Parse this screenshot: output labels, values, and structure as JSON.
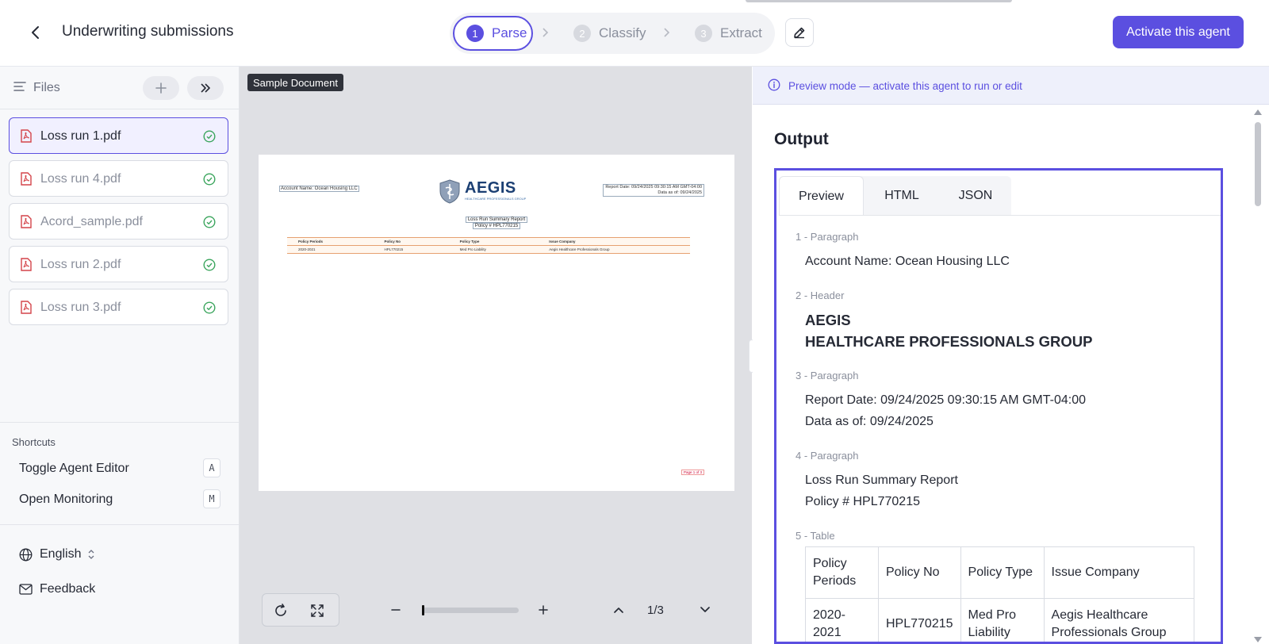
{
  "header": {
    "title": "Underwriting submissions",
    "steps": [
      {
        "num": "1",
        "label": "Parse"
      },
      {
        "num": "2",
        "label": "Classify"
      },
      {
        "num": "3",
        "label": "Extract"
      }
    ],
    "activate_label": "Activate this agent",
    "accent": "#5b4fe0"
  },
  "sidebar": {
    "files_label": "Files",
    "files": [
      {
        "name": "Loss run 1.pdf",
        "status": "check-circle-icon"
      },
      {
        "name": "Loss run 4.pdf",
        "status": "check-circle-icon"
      },
      {
        "name": "Acord_sample.pdf",
        "status": "check-circle-icon"
      },
      {
        "name": "Loss run 2.pdf",
        "status": "check-circle-icon"
      },
      {
        "name": "Loss run 3.pdf",
        "status": "check-circle-icon"
      }
    ],
    "shortcuts_title": "Shortcuts",
    "shortcuts": [
      {
        "label": "Toggle Agent Editor",
        "key": "A"
      },
      {
        "label": "Open Monitoring",
        "key": "M"
      }
    ],
    "language": "English",
    "feedback": "Feedback"
  },
  "viewer": {
    "tag": "Sample Document",
    "page": {
      "account": "Account Name: Ocean Housing LLC",
      "logo_word": "AEGIS",
      "logo_sub": "HEALTHCARE PROFESSIONALS GROUP",
      "report_date": "Report Date: 09/24/2025 09:30:15 AM GMT-04:00",
      "data_as_of": "Data as of: 09/24/2025",
      "title": "Loss Run Summary Report",
      "policy": "Policy # HPL770215",
      "table_head": [
        "Policy Periods",
        "Policy No",
        "Policy Type",
        "Issue Company"
      ],
      "table_row": [
        "2020-2021",
        "HPL770215",
        "Med Pro Liability",
        "Aegis Healthcare Professionals Group"
      ],
      "footer": "Page 1 of 3"
    },
    "zoom_fraction": 0.0,
    "page_indicator": "1/3"
  },
  "output": {
    "banner": "Preview mode — activate this agent to run or edit",
    "title": "Output",
    "tabs": [
      "Preview",
      "HTML",
      "JSON"
    ],
    "blocks": [
      {
        "label": "1 - Paragraph",
        "lines": [
          "Account Name: Ocean Housing LLC"
        ]
      },
      {
        "label": "2 - Header",
        "lines": [
          "AEGIS",
          "HEALTHCARE PROFESSIONALS GROUP"
        ]
      },
      {
        "label": "3 - Paragraph",
        "lines": [
          "Report Date: 09/24/2025 09:30:15 AM GMT-04:00",
          "Data as of: 09/24/2025"
        ]
      },
      {
        "label": "4 - Paragraph",
        "lines": [
          "Loss Run Summary Report",
          "Policy # HPL770215"
        ]
      },
      {
        "label": "5 - Table"
      }
    ],
    "table": {
      "head": [
        "Policy Periods",
        "Policy No",
        "Policy Type",
        "Issue Company"
      ],
      "row": [
        "2020-2021",
        "HPL770215",
        "Med Pro Liability",
        "Aegis Healthcare Professionals Group"
      ]
    }
  }
}
